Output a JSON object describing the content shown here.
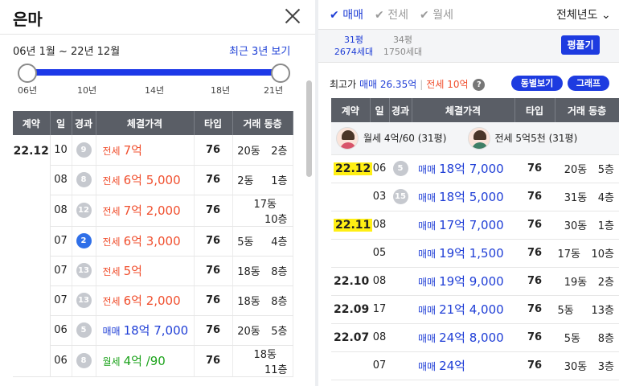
{
  "left": {
    "title": "은마",
    "range_text": "06년 1월 ~ 22년 12월",
    "recent_link": "최근 3년 보기",
    "ticks": [
      "06년",
      "10년",
      "14년",
      "18년",
      "21년"
    ],
    "headers": [
      "계약",
      "일",
      "경과",
      "체결가격",
      "타입",
      "거래 동층"
    ],
    "contract_month": "22.12",
    "rows": [
      {
        "day": "10",
        "elapsed": "9",
        "ptype": "전세",
        "price": "7억",
        "kind": "jeon",
        "type": "76",
        "building": "20동",
        "floor": "2층",
        "blue": false
      },
      {
        "day": "08",
        "elapsed": "8",
        "ptype": "전세",
        "price": "6억 5,000",
        "kind": "jeon",
        "type": "76",
        "building": "2동",
        "floor": "1층",
        "blue": false
      },
      {
        "day": "08",
        "elapsed": "12",
        "ptype": "전세",
        "price": "7억 2,000",
        "kind": "jeon",
        "type": "76",
        "building": "17동",
        "floor": "10층",
        "blue": false
      },
      {
        "day": "07",
        "elapsed": "2",
        "ptype": "전세",
        "price": "6억 3,000",
        "kind": "jeon",
        "type": "76",
        "building": "5동",
        "floor": "4층",
        "blue": true
      },
      {
        "day": "07",
        "elapsed": "13",
        "ptype": "전세",
        "price": "5억",
        "kind": "jeon",
        "type": "76",
        "building": "18동",
        "floor": "8층",
        "blue": false
      },
      {
        "day": "07",
        "elapsed": "13",
        "ptype": "전세",
        "price": "6억 2,000",
        "kind": "jeon",
        "type": "76",
        "building": "18동",
        "floor": "8층",
        "blue": false
      },
      {
        "day": "06",
        "elapsed": "5",
        "ptype": "매매",
        "price": "18억 7,000",
        "kind": "mae",
        "type": "76",
        "building": "20동",
        "floor": "5층",
        "blue": false
      },
      {
        "day": "06",
        "elapsed": "8",
        "ptype": "월세",
        "price": "4억 /90",
        "kind": "wol",
        "type": "76",
        "building": "18동",
        "floor": "11층",
        "blue": false
      }
    ]
  },
  "right": {
    "tabs": [
      {
        "label": "매매",
        "on": true
      },
      {
        "label": "전세",
        "on": false
      },
      {
        "label": "월세",
        "on": false
      }
    ],
    "year_select": "전체년도",
    "sizes": [
      {
        "line1": "31평",
        "line2": "2674세대",
        "on": true
      },
      {
        "line1": "34평",
        "line2": "1750세대",
        "on": false
      }
    ],
    "pyeong_button": "평풀기",
    "max_label": "최고가",
    "max_mae": "매매 26.35억",
    "max_jeon": "전세 10억",
    "help_icon": "?",
    "btn_dong": "동별보기",
    "btn_graph": "그래프",
    "headers": [
      "계약",
      "일",
      "경과",
      "체결가격",
      "타입",
      "거래 동층"
    ],
    "profile": {
      "rent_text": "월세 4억/60 (31평)",
      "jeonse_text": "전세 5억5천 (31평)"
    },
    "rows": [
      {
        "month": "22.12",
        "highlight": true,
        "day": "06",
        "elapsed": "5",
        "ptype": "매매",
        "price": "18억 7,000",
        "type": "76",
        "building": "20동",
        "floor": "5층"
      },
      {
        "month": "",
        "highlight": false,
        "day": "03",
        "elapsed": "15",
        "ptype": "매매",
        "price": "18억 5,000",
        "type": "76",
        "building": "31동",
        "floor": "4층"
      },
      {
        "month": "22.11",
        "highlight": true,
        "day": "08",
        "elapsed": "",
        "ptype": "매매",
        "price": "17억 7,000",
        "type": "76",
        "building": "30동",
        "floor": "1층"
      },
      {
        "month": "",
        "highlight": false,
        "day": "05",
        "elapsed": "",
        "ptype": "매매",
        "price": "19억 1,500",
        "type": "76",
        "building": "17동",
        "floor": "10층"
      },
      {
        "month": "22.10",
        "highlight": false,
        "day": "08",
        "elapsed": "",
        "ptype": "매매",
        "price": "19억 9,000",
        "type": "76",
        "building": "19동",
        "floor": "2층"
      },
      {
        "month": "22.09",
        "highlight": false,
        "day": "17",
        "elapsed": "",
        "ptype": "매매",
        "price": "21억 4,000",
        "type": "76",
        "building": "5동",
        "floor": "13층"
      },
      {
        "month": "22.07",
        "highlight": false,
        "day": "08",
        "elapsed": "",
        "ptype": "매매",
        "price": "24억 8,000",
        "type": "76",
        "building": "5동",
        "floor": "8층"
      },
      {
        "month": "",
        "highlight": false,
        "day": "07",
        "elapsed": "",
        "ptype": "매매",
        "price": "24억",
        "type": "76",
        "building": "30동",
        "floor": "3층"
      }
    ]
  },
  "colors": {
    "jeon": "#f04f2e",
    "mae": "#1f3ed6",
    "wol": "#1da31c",
    "accent": "#1d3be0",
    "highlight": "#ffef14"
  }
}
